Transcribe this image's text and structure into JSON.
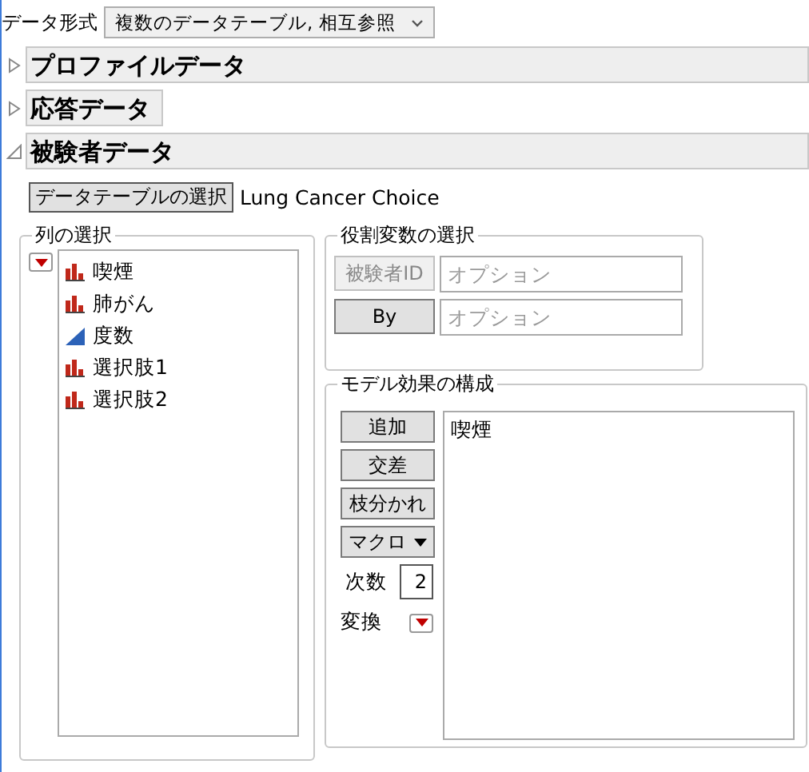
{
  "data_format": {
    "label": "データ形式",
    "value": "複数のデータテーブル, 相互参照"
  },
  "sections": [
    {
      "title": "プロファイルデータ",
      "expanded": false,
      "wide": true
    },
    {
      "title": "応答データ",
      "expanded": false,
      "wide": false
    },
    {
      "title": "被験者データ",
      "expanded": true,
      "wide": true
    }
  ],
  "table_select": {
    "button": "データテーブルの選択",
    "table": "Lung Cancer Choice"
  },
  "column_select": {
    "title": "列の選択",
    "columns": [
      {
        "name": "喫煙",
        "kind": "nominal"
      },
      {
        "name": "肺がん",
        "kind": "nominal"
      },
      {
        "name": "度数",
        "kind": "continuous"
      },
      {
        "name": "選択肢1",
        "kind": "nominal"
      },
      {
        "name": "選択肢2",
        "kind": "nominal"
      }
    ]
  },
  "roles": {
    "title": "役割変数の選択",
    "rows": [
      {
        "button": "被験者ID",
        "disabled": true,
        "placeholder": "オプション"
      },
      {
        "button": "By",
        "disabled": false,
        "placeholder": "オプション"
      }
    ]
  },
  "model": {
    "title": "モデル効果の構成",
    "buttons": [
      {
        "label": "追加",
        "kind": "plain"
      },
      {
        "label": "交差",
        "kind": "plain"
      },
      {
        "label": "枝分かれ",
        "kind": "plain"
      },
      {
        "label": "マクロ",
        "kind": "menu"
      }
    ],
    "degree_label": "次数",
    "degree": "2",
    "transform_label": "変換",
    "effects": [
      "喫煙"
    ]
  }
}
